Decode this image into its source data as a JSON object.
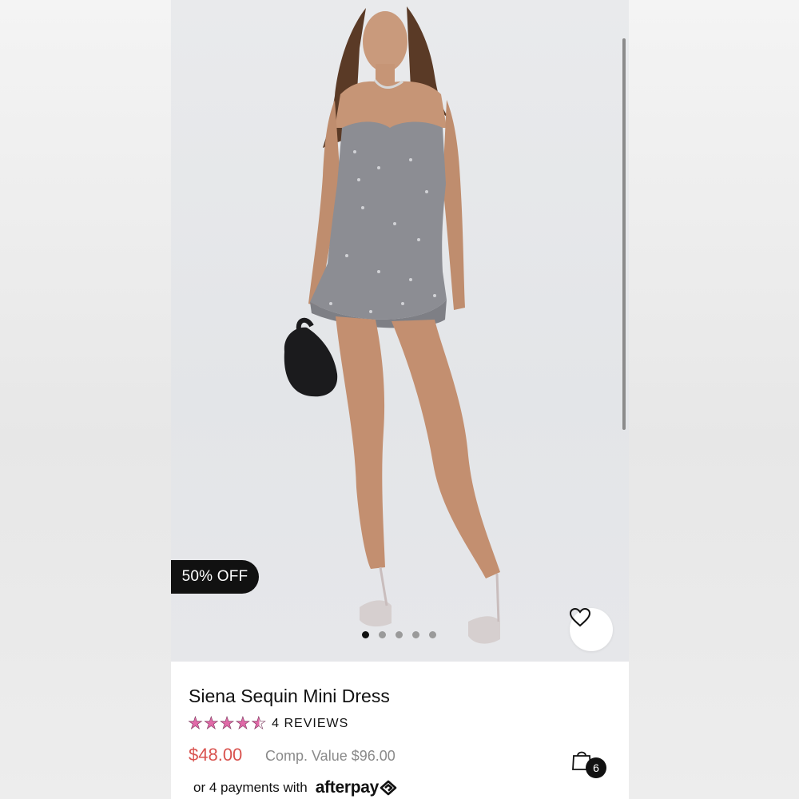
{
  "product": {
    "badge": "50% OFF",
    "name": "Siena Sequin Mini Dress",
    "rating": 4.5,
    "reviews_label": "4 REVIEWS",
    "price": "$48.00",
    "comp_value": "Comp. Value $96.00",
    "payments_text": "or 4 payments with",
    "afterpay_label": "afterpay"
  },
  "gallery": {
    "dot_count": 5,
    "active_index": 0
  },
  "cart": {
    "count": "6"
  },
  "colors": {
    "price": "#d9534f",
    "stars": "#e06aa8",
    "badge_bg": "#111111"
  },
  "icons": {
    "favorite": "heart-icon",
    "cart": "shopping-bag-icon",
    "afterpay": "afterpay-logo-icon",
    "star": "star-icon"
  }
}
